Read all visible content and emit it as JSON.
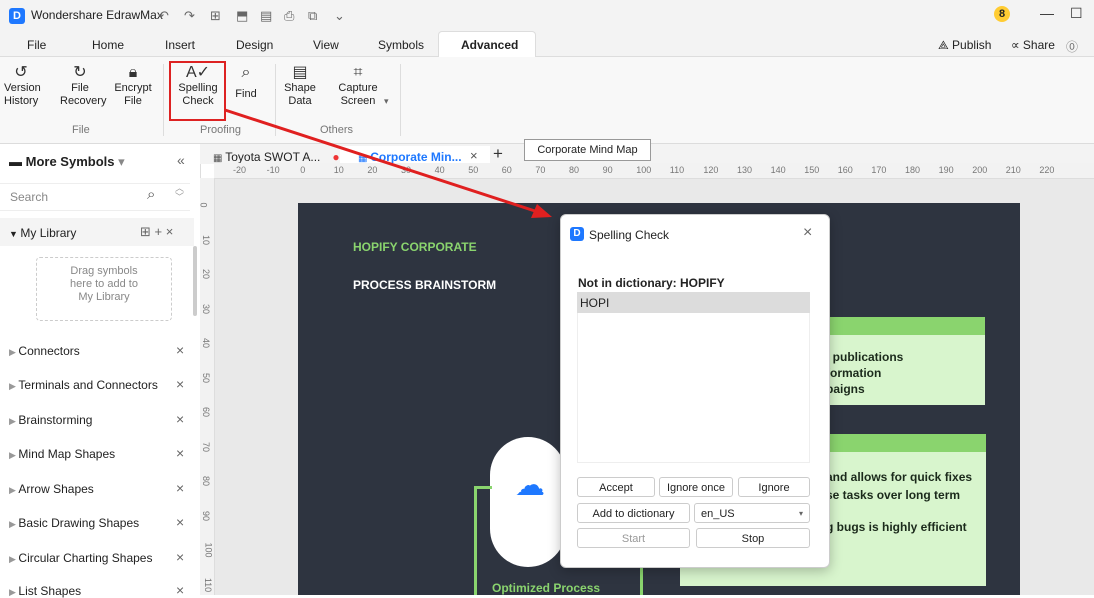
{
  "app": {
    "title": "Wondershare EdrawMax",
    "notif_count": "8"
  },
  "quick_access": [
    "↶",
    "↷",
    "⊞",
    "⬒",
    "▤",
    "⎙",
    "⧉",
    "⌄"
  ],
  "menu": {
    "items": [
      "File",
      "Home",
      "Insert",
      "Design",
      "View",
      "Symbols",
      "Advanced"
    ],
    "active": "Advanced",
    "publish": "Publish",
    "share": "Share"
  },
  "ribbon": {
    "file_group": {
      "label": "File",
      "buttons": [
        {
          "line1": "Version",
          "line2": "History"
        },
        {
          "line1": "File",
          "line2": "Recovery"
        },
        {
          "line1": "Encrypt",
          "line2": "File"
        }
      ]
    },
    "proofing_group": {
      "label": "Proofing",
      "buttons": [
        {
          "line1": "Spelling",
          "line2": "Check"
        },
        {
          "line1": "Find",
          "line2": ""
        }
      ]
    },
    "others_group": {
      "label": "Others",
      "buttons": [
        {
          "line1": "Shape",
          "line2": "Data"
        },
        {
          "line1": "Capture",
          "line2": "Screen"
        }
      ]
    }
  },
  "sidebar": {
    "title": "More Symbols",
    "search_placeholder": "Search",
    "library": "My Library",
    "drag_text": [
      "Drag symbols",
      "here to add to",
      "My Library"
    ],
    "items": [
      "Connectors",
      "Terminals and Connectors",
      "Brainstorming",
      "Mind Map Shapes",
      "Arrow Shapes",
      "Basic Drawing Shapes",
      "Circular Charting Shapes",
      "List Shapes"
    ]
  },
  "tabs": {
    "doc1": "Toyota SWOT A...",
    "doc2": "Corporate Min...",
    "tooltip": "Corporate Mind Map"
  },
  "ruler": {
    "h": [
      "-20",
      "-10",
      "0",
      "10",
      "20",
      "30",
      "40",
      "50",
      "60",
      "70",
      "80",
      "90",
      "100",
      "110",
      "120",
      "130",
      "140",
      "150",
      "160",
      "170",
      "180",
      "190",
      "200",
      "210",
      "220"
    ],
    "v": [
      "0",
      "10",
      "20",
      "30",
      "40",
      "50",
      "60",
      "70",
      "80",
      "90",
      "100",
      "110"
    ]
  },
  "canvas": {
    "heading1": "HOPIFY CORPORATE",
    "heading2": "PROCESS BRAINSTORM",
    "card1": [
      "l publications",
      "formation",
      "paigns"
    ],
    "card2": [
      "and allows for quick fixes",
      "se tasks over long term",
      "g bugs is highly efficient"
    ],
    "bottom": "Optimized Process"
  },
  "dialog": {
    "title": "Spelling Check",
    "not_in_dict": "Not in dictionary: HOPIFY",
    "suggestion": "HOPI",
    "accept": "Accept",
    "ignore_once": "Ignore once",
    "ignore": "Ignore",
    "add": "Add to dictionary",
    "lang": "en_US",
    "start": "Start",
    "stop": "Stop"
  },
  "colors": {
    "accent": "#1e78ff",
    "canvas_bg": "#2e3440",
    "green": "#8ad46e",
    "highlight": "#d22222"
  }
}
